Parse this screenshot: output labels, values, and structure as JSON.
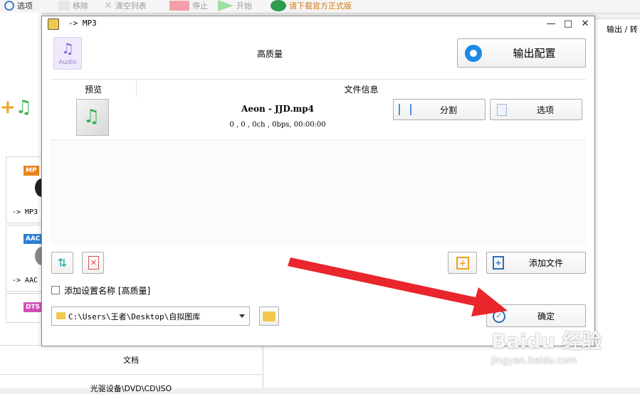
{
  "background_app": {
    "toolbar": {
      "options_label": "选项",
      "remove_label": "移除",
      "clear_list_label": "清空列表",
      "stop_label": "停止",
      "start_label": "开始",
      "download_label": "请下载官方正式版"
    },
    "tiles": [
      {
        "badge": "MP",
        "caption": "-> MP3",
        "badge_color": "#e8841a"
      },
      {
        "badge": "AAC",
        "caption": "-> AAC",
        "badge_color": "#2f7fd1"
      },
      {
        "badge": "DTS",
        "caption": "",
        "badge_color": "#d14fb5"
      }
    ],
    "right_header_label": "输出 / 转",
    "bottom_items": [
      "文档",
      "光驱设备\\DVD\\CD\\ISO"
    ]
  },
  "dialog": {
    "title": "-> MP3",
    "window_controls": {
      "minimize": "—",
      "maximize": "□",
      "close": "✕"
    },
    "preset_icon_label": "Audio",
    "quality_label": "高质量",
    "output_config_label": "输出配置",
    "list_headers": {
      "preview": "预览",
      "file_info": "文件信息"
    },
    "files": [
      {
        "name": "Aeon - JJD.mp4",
        "details": "0 , 0 , 0ch , 0bps, 00:00:00",
        "split_label": "分割",
        "options_label": "选项"
      }
    ],
    "add_file_label": "添加文件",
    "add_setting_checkbox_label": "添加设置名称 [高质量]",
    "add_setting_checked": false,
    "output_path": "C:\\Users\\王者\\Desktop\\自拟图库",
    "ok_label": "确定"
  },
  "watermark": {
    "brand": "Baidu 经验",
    "url": "jingyan.baidu.com"
  },
  "colors": {
    "accent": "#1e88e5",
    "annotation_arrow": "#e8262b",
    "folder": "#f2c94c"
  }
}
